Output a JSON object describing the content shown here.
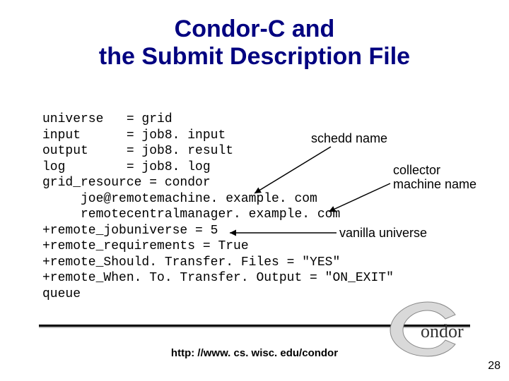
{
  "title_line1": "Condor-C and",
  "title_line2": "the Submit Description File",
  "code": {
    "l01": "universe   = grid",
    "l02": "input      = job8. input",
    "l03": "output     = job8. result",
    "l04": "log        = job8. log",
    "l05": "grid_resource = condor",
    "l06": "     joe@remotemachine. example. com",
    "l07": "     remotecentralmanager. example. com",
    "l08": "+remote_jobuniverse = 5",
    "l09": "+remote_requirements = True",
    "l10": "+remote_Should. Transfer. Files = \"YES\"",
    "l11": "+remote_When. To. Transfer. Output = \"ON_EXIT\"",
    "l12": "queue"
  },
  "annotations": {
    "schedd": "schedd name",
    "collector_l1": "collector",
    "collector_l2": "machine name",
    "vanilla": "vanilla universe"
  },
  "footer_url": "http: //www. cs. wisc. edu/condor",
  "page_number": "28",
  "logo_text": "ondor"
}
